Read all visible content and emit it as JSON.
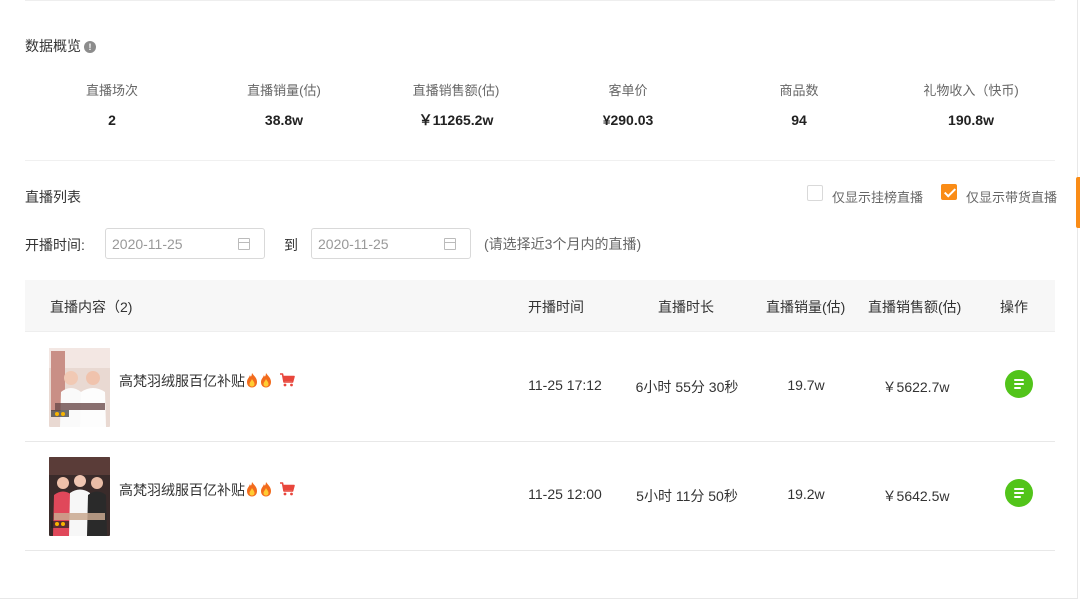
{
  "overview": {
    "title": "数据概览",
    "info_icon": "!",
    "stats": [
      {
        "label": "直播场次",
        "value": "2"
      },
      {
        "label": "直播销量(估)",
        "value": "38.8w"
      },
      {
        "label": "直播销售额(估)",
        "value": "￥11265.2w"
      },
      {
        "label": "客单价",
        "value": "¥290.03"
      },
      {
        "label": "商品数",
        "value": "94"
      },
      {
        "label": "礼物收入（快币)",
        "value": "190.8w"
      }
    ]
  },
  "list": {
    "title": "直播列表",
    "filter_hot_label": "仅显示挂榜直播",
    "filter_hot_checked": false,
    "filter_goods_label": "仅显示带货直播",
    "filter_goods_checked": true,
    "date_label": "开播时间:",
    "date_start": "2020-11-25",
    "date_to": "到",
    "date_end": "2020-11-25",
    "hint": "(请选择近3个月内的直播)",
    "columns": {
      "content": "直播内容（2)",
      "start_time": "开播时间",
      "duration": "直播时长",
      "sales": "直播销量(估)",
      "revenue": "直播销售额(估)",
      "action": "操作"
    },
    "rows": [
      {
        "title": "高梵羽绒服百亿补贴",
        "start_time": "11-25 17:12",
        "duration": "6小时 55分 30秒",
        "sales": "19.7w",
        "revenue": "￥5622.7w"
      },
      {
        "title": "高梵羽绒服百亿补贴",
        "start_time": "11-25 12:00",
        "duration": "5小时 11分 50秒",
        "sales": "19.2w",
        "revenue": "￥5642.5w"
      }
    ]
  },
  "colors": {
    "accent": "#fa8c16",
    "action_green": "#52c41a",
    "cart_red": "#e8463c"
  },
  "icons": {
    "info": "info-icon",
    "calendar": "calendar-icon",
    "flame": "flame-icon",
    "cart": "cart-icon",
    "detail": "list-detail-icon"
  }
}
